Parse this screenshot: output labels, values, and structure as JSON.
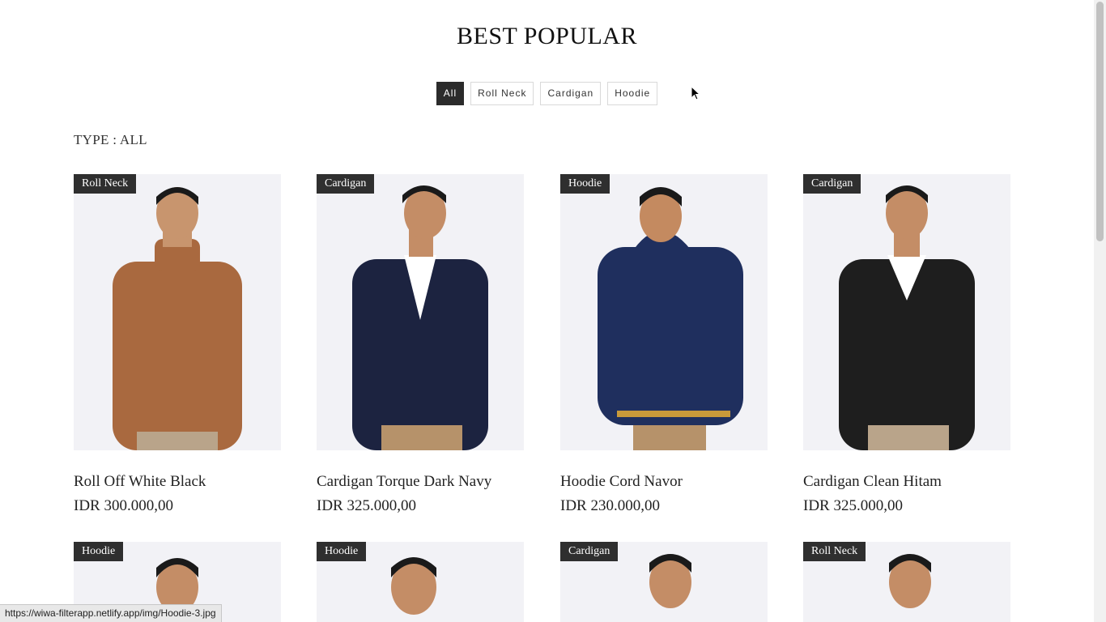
{
  "page": {
    "title": "BEST POPULAR",
    "type_label": "TYPE : ALL"
  },
  "filters": [
    "All",
    "Roll Neck",
    "Cardigan",
    "Hoodie"
  ],
  "active_filter": "All",
  "products": [
    {
      "badge": "Roll Neck",
      "name": "Roll Off White Black",
      "price": "IDR 300.000,00",
      "sweater_color": "#a9693f"
    },
    {
      "badge": "Cardigan",
      "name": "Cardigan Torque Dark Navy",
      "price": "IDR 325.000,00",
      "sweater_color": "#1c2340"
    },
    {
      "badge": "Hoodie",
      "name": "Hoodie Cord Navor",
      "price": "IDR 230.000,00",
      "sweater_color": "#1f2f5e"
    },
    {
      "badge": "Cardigan",
      "name": "Cardigan Clean Hitam",
      "price": "IDR 325.000,00",
      "sweater_color": "#1e1e1e"
    }
  ],
  "products_row2": [
    {
      "badge": "Hoodie"
    },
    {
      "badge": "Hoodie"
    },
    {
      "badge": "Cardigan"
    },
    {
      "badge": "Roll Neck"
    }
  ],
  "status_bar": {
    "url": "https://wiwa-filterapp.netlify.app/img/Hoodie-3.jpg"
  },
  "colors": {
    "badge_bg": "#2f2f2f",
    "active_filter_bg": "#2b2b2b",
    "image_bg": "#f2f2f6"
  }
}
